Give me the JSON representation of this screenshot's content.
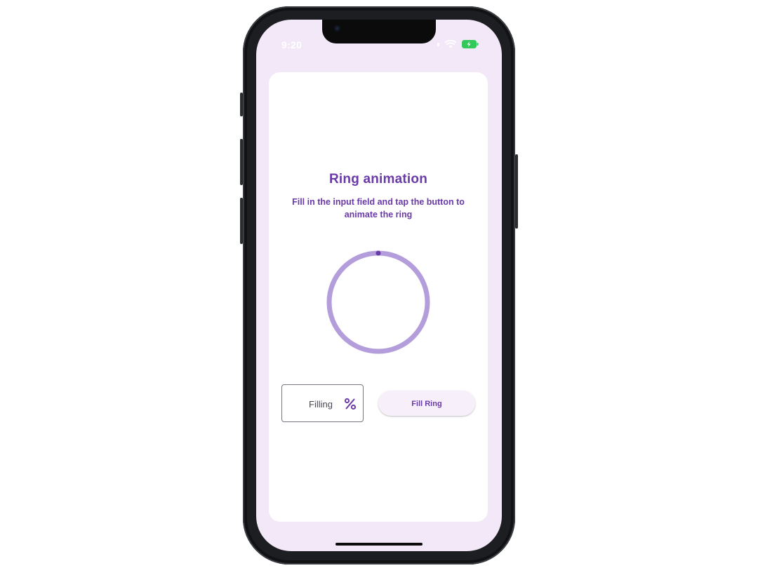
{
  "status_bar": {
    "time": "9:20"
  },
  "card": {
    "title": "Ring animation",
    "subtitle": "Fill in the input field and tap the button to animate the ring"
  },
  "ring": {
    "progress_percent": 0,
    "track_color": "#b39ddb",
    "indicator_color": "#6a3aa8"
  },
  "input": {
    "label": "Filling",
    "suffix_icon": "percent-icon"
  },
  "button": {
    "label": "Fill Ring"
  },
  "colors": {
    "accent": "#6a3aa8",
    "background": "#f3e8f8",
    "card": "#ffffff"
  }
}
